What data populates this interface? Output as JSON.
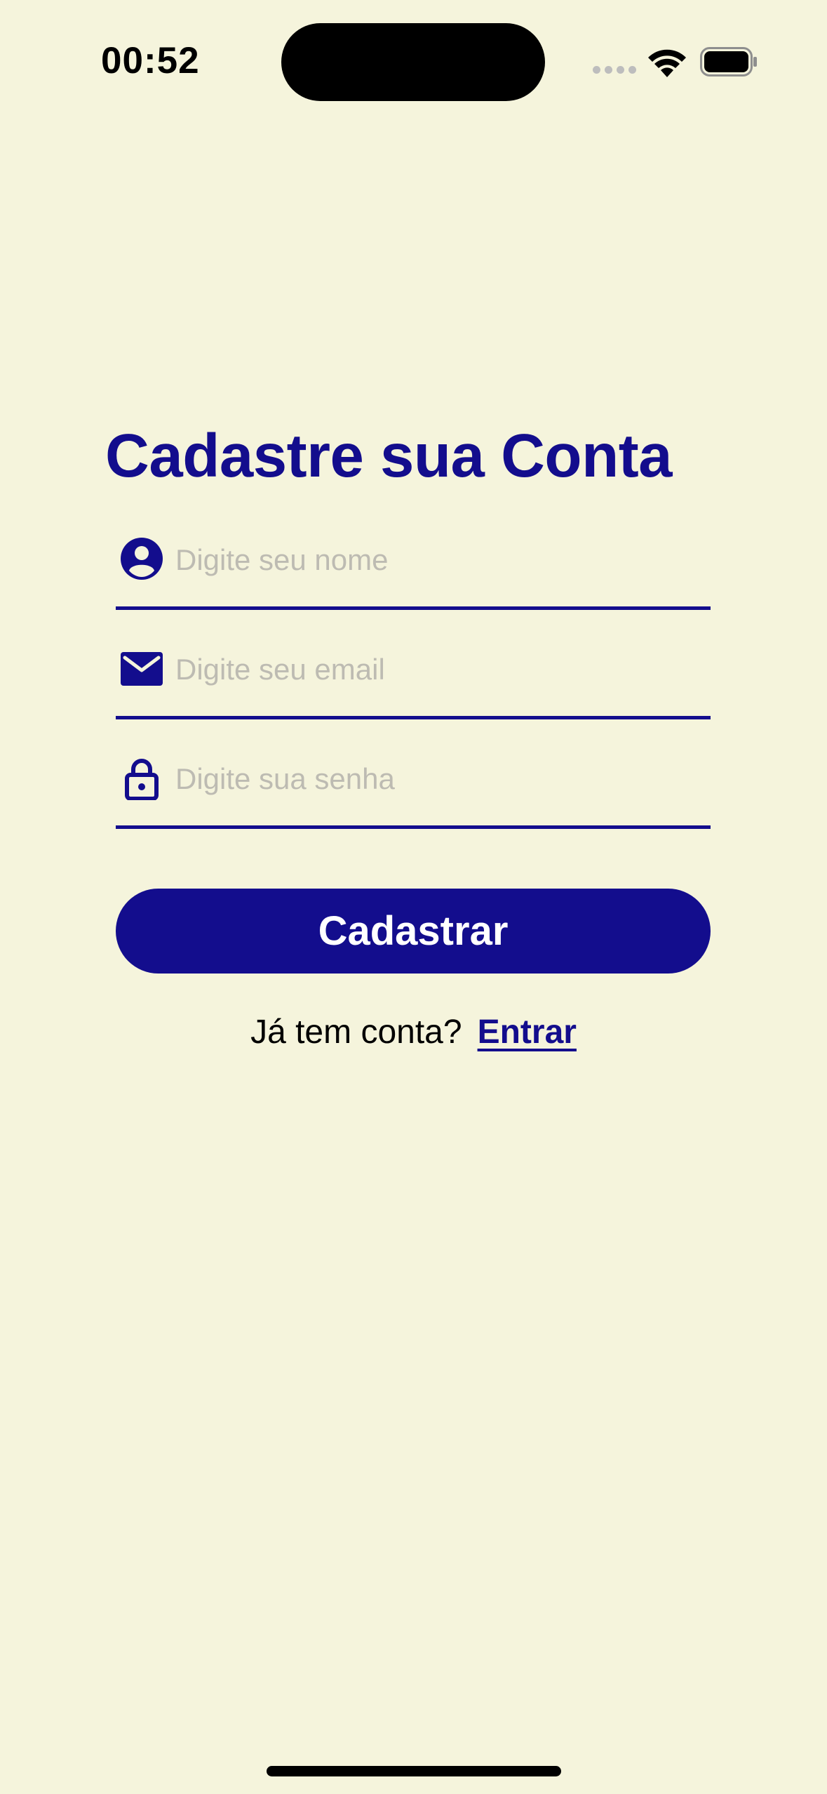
{
  "status_bar": {
    "time": "00:52"
  },
  "form": {
    "title": "Cadastre sua Conta",
    "fields": [
      {
        "icon": "user-circle-icon",
        "placeholder": "Digite seu nome",
        "value": ""
      },
      {
        "icon": "envelope-icon",
        "placeholder": "Digite seu email",
        "value": ""
      },
      {
        "icon": "lock-icon",
        "placeholder": "Digite sua senha",
        "value": ""
      }
    ],
    "submit_label": "Cadastrar",
    "login_prompt": "Já tem conta?",
    "login_link": "Entrar"
  },
  "colors": {
    "background": "#F5F4DC",
    "primary": "#130D8D",
    "placeholder": "#BDBBB2"
  }
}
